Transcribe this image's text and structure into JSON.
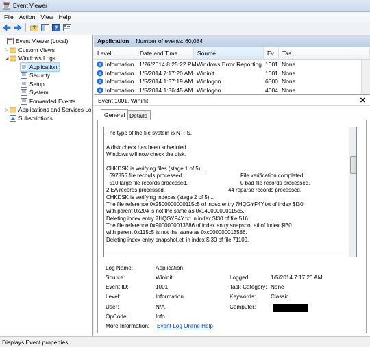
{
  "window": {
    "title": "Event Viewer"
  },
  "menu": [
    "File",
    "Action",
    "View",
    "Help"
  ],
  "tree": {
    "root": "Event Viewer (Local)",
    "items": [
      {
        "label": "Custom Views"
      },
      {
        "label": "Windows Logs"
      },
      {
        "label": "Application"
      },
      {
        "label": "Security"
      },
      {
        "label": "Setup"
      },
      {
        "label": "System"
      },
      {
        "label": "Forwarded Events"
      },
      {
        "label": "Applications and Services Lo"
      },
      {
        "label": "Subscriptions"
      }
    ]
  },
  "log_header": {
    "name": "Application",
    "count_text": "Number of events: 60,084"
  },
  "grid": {
    "columns": [
      "Level",
      "Date and Time",
      "Source",
      "Ev...",
      "Tas..."
    ],
    "rows": [
      {
        "level": "Information",
        "datetime": "1/26/2014 8:25:22 PM",
        "source": "Windows Error Reporting",
        "event_id": "1001",
        "task": "None"
      },
      {
        "level": "Information",
        "datetime": "1/5/2014 7:17:20 AM",
        "source": "Wininit",
        "event_id": "1001",
        "task": "None"
      },
      {
        "level": "Information",
        "datetime": "1/5/2014 1:37:19 AM",
        "source": "Winlogon",
        "event_id": "6000",
        "task": "None"
      },
      {
        "level": "Information",
        "datetime": "1/5/2014 1:36:45 AM",
        "source": "Winlogon",
        "event_id": "4004",
        "task": "None"
      }
    ]
  },
  "detail": {
    "title": "Event 1001, Wininit",
    "tabs": [
      "General",
      "Details"
    ],
    "description_lines": [
      {
        "a": "The type of the file system is NTFS.",
        "b": ""
      },
      {
        "a": "",
        "b": ""
      },
      {
        "a": "A disk check has been scheduled.",
        "b": ""
      },
      {
        "a": "Windows will now check the disk.",
        "b": ""
      },
      {
        "a": "",
        "b": ""
      },
      {
        "a": "CHKDSK is verifying files (stage 1 of 5)...",
        "b": ""
      },
      {
        "a": "  697856 file records processed.",
        "b": "File verification completed."
      },
      {
        "a": "  510 large file records processed.",
        "b": "0 bad file records processed."
      },
      {
        "a": "2 EA records processed.",
        "b": "44 reparse records processed."
      },
      {
        "a": "CHKDSK is verifying indexes (stage 2 of 5)...",
        "b": ""
      },
      {
        "a": "The file reference 0x2500000000115c5 of index entry 7HQGYF4Y.txt of index $I30",
        "b": ""
      },
      {
        "a": "with parent 0x204 is not the same as 0x140000000115c5.",
        "b": ""
      },
      {
        "a": "Deleting index entry 7HQGYF4Y.txt in index $I30 of file 516.",
        "b": ""
      },
      {
        "a": "The file reference 0x9000000013586 of index entry snapshot.etl of index $I30",
        "b": ""
      },
      {
        "a": "with parent 0x115c5 is not the same as 0xc000000013586.",
        "b": ""
      },
      {
        "a": "Deleting index entry snapshot.etl in index $I30 of file 71109.",
        "b": ""
      }
    ],
    "fields": {
      "log_name_label": "Log Name:",
      "log_name": "Application",
      "source_label": "Source:",
      "source": "Wininit",
      "logged_label": "Logged:",
      "logged": "1/5/2014 7:17:20 AM",
      "event_id_label": "Event ID:",
      "event_id": "1001",
      "task_category_label": "Task Category:",
      "task_category": "None",
      "level_label": "Level:",
      "level": "Information",
      "keywords_label": "Keywords:",
      "keywords": "Classic",
      "user_label": "User:",
      "user": "N/A",
      "computer_label": "Computer:",
      "opcode_label": "OpCode:",
      "opcode": "Info",
      "more_info_label": "More Information:",
      "more_info_link": "Event Log Online Help"
    }
  },
  "status": {
    "text": "Displays Event properties."
  },
  "colors": {
    "selection": "#cde8ff",
    "link": "#0033cc",
    "info_icon": "#1e6fd9"
  }
}
